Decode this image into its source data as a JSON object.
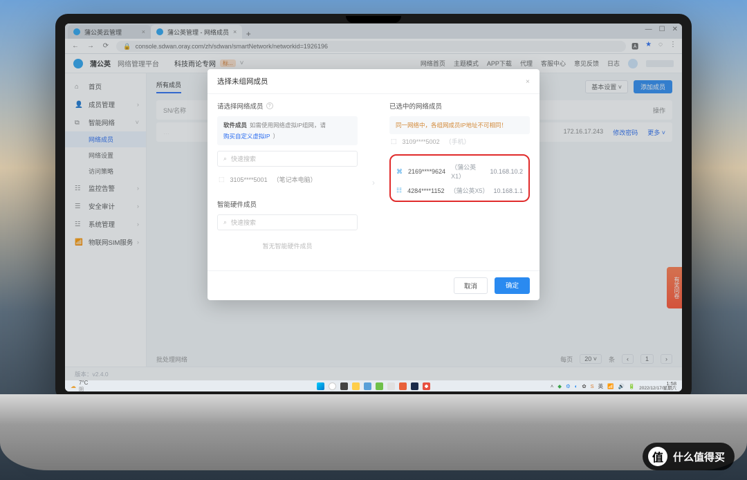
{
  "browser": {
    "tabs": [
      {
        "title": "蒲公英云管理",
        "active": false
      },
      {
        "title": "蒲公英管理 - 网络成员",
        "active": true
      }
    ],
    "url": "console.sdwan.oray.com/zh/sdwan/smartNetwork/networkid=1926196",
    "win": {
      "min": "—",
      "max": "☐",
      "close": "✕"
    }
  },
  "appHeader": {
    "brand": "蒲公英",
    "product": "网络管理平台",
    "network_name": "科技雨论专网",
    "network_badge": "标...",
    "links": [
      "网络首页",
      "主题模式",
      "APP下载",
      "代理",
      "客服中心",
      "意见反馈",
      "日志"
    ],
    "username": ""
  },
  "sidebar": {
    "items": [
      {
        "icon": "⌂",
        "label": "首页"
      },
      {
        "icon": "👤",
        "label": "成员管理",
        "expandable": true
      },
      {
        "icon": "⧉",
        "label": "智能网络",
        "expandable": true,
        "open": true,
        "subs": [
          {
            "label": "网络成员",
            "active": true
          },
          {
            "label": "网络设置"
          },
          {
            "label": "访问策略"
          }
        ]
      },
      {
        "icon": "☷",
        "label": "监控告警",
        "expandable": true
      },
      {
        "icon": "☰",
        "label": "安全审计",
        "expandable": true
      },
      {
        "icon": "☳",
        "label": "系统管理",
        "expandable": true
      },
      {
        "icon": "📶",
        "label": "物联网SIM服务",
        "expandable": true
      }
    ]
  },
  "main": {
    "tab_all": "所有成员",
    "filter_label": "基本设置",
    "add_btn": "添加成员",
    "sn_label": "SN/名称",
    "ops_label": "操作",
    "row_ip": "172.16.17.243",
    "row_action1": "修改密码",
    "row_action2": "更多",
    "batch_label": "批处理网络",
    "pager_count_lbl": "每页",
    "pager_count": "20",
    "pager_unit": "条",
    "page_cur": "1"
  },
  "modal": {
    "title": "选择未组网成员",
    "left_title": "请选择网络成员",
    "right_title": "已选中的网络成员",
    "sw_section": "软件成员",
    "sw_hint": "如需使用网络虚拟IP组网，请",
    "sw_link": "购买自定义虚拟IP",
    "search_ph": "快速搜索",
    "sw_member": {
      "sn": "3105****5001",
      "desc": "（笔记本电脑）"
    },
    "hw_section": "智能硬件成员",
    "hw_empty": "暂无智能硬件成员",
    "right_warn": "同一网络中，各组网成员IP地址不可相同！",
    "right_items": [
      {
        "icon": "ghost",
        "sn": "3109****5002",
        "desc": "（手机）",
        "ip": ""
      },
      {
        "icon": "rtr",
        "sn": "2169****9624",
        "desc": "（蒲公英X1）",
        "ip": "10.168.10.2"
      },
      {
        "icon": "dev",
        "sn": "4284****1152",
        "desc": "（蒲公英X5）",
        "ip": "10.168.1.1"
      }
    ],
    "cancel": "取消",
    "ok": "确定"
  },
  "side_ad": "有奖问卷",
  "version": "版本：v2.4.0",
  "taskbar": {
    "temp": "7°C",
    "cond": "阴",
    "time": "1:58",
    "date": "2022/12/17/星期六"
  },
  "watermark": {
    "glyph": "值",
    "text": "什么值得买"
  }
}
